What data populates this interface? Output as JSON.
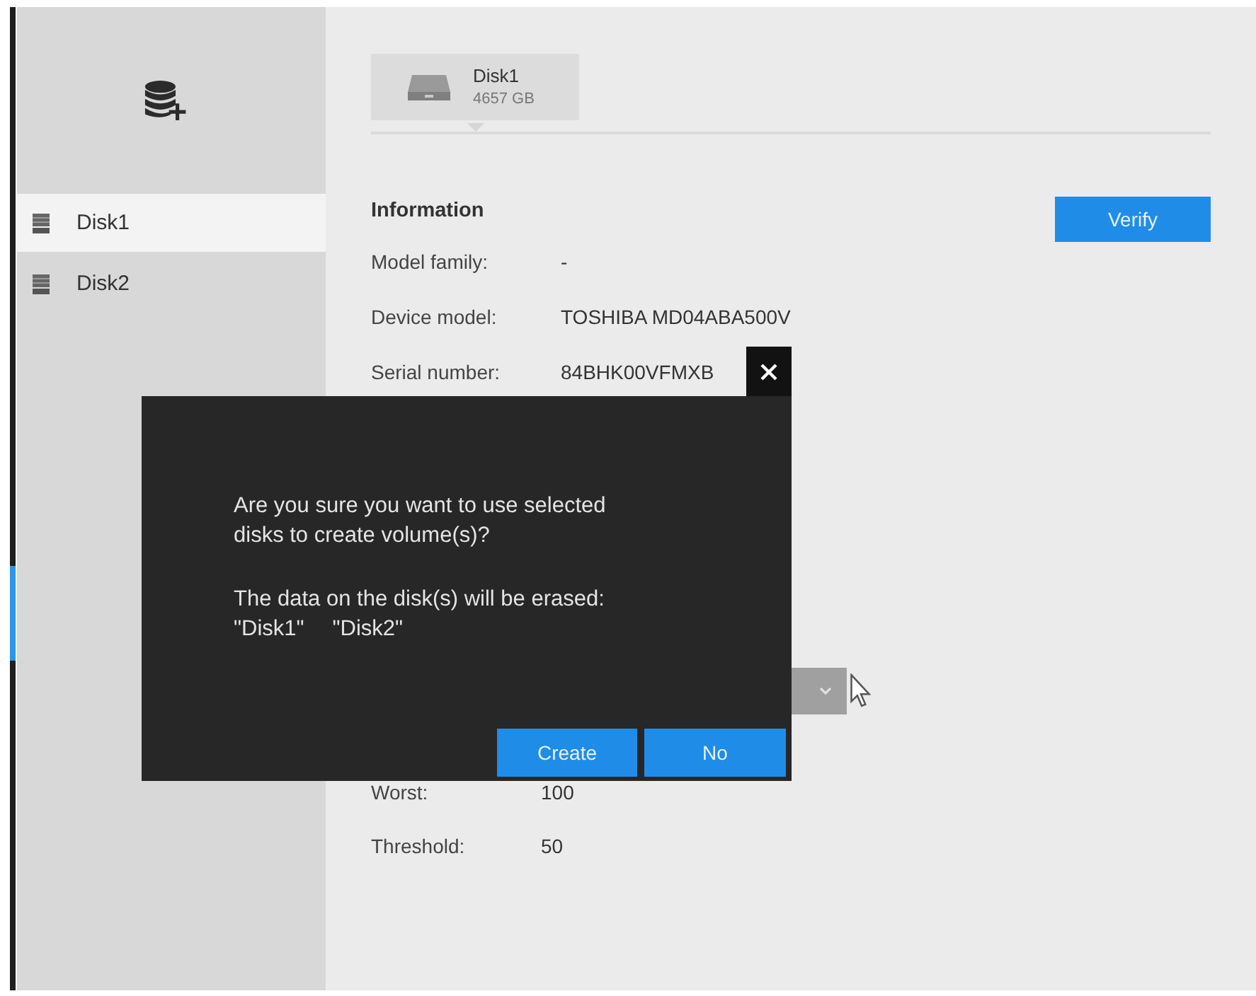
{
  "sidebar": {
    "items": [
      {
        "label": "Disk1",
        "selected": true
      },
      {
        "label": "Disk2",
        "selected": false
      }
    ]
  },
  "disk_tabs": [
    {
      "name": "Disk1",
      "size": "4657 GB",
      "selected": true
    }
  ],
  "information": {
    "title": "Information",
    "verify_button": "Verify",
    "fields": [
      {
        "label": "Model family:",
        "value": "-"
      },
      {
        "label": "Device model:",
        "value": "TOSHIBA MD04ABA500V"
      },
      {
        "label": "Serial number:",
        "value": "84BHK00VFMXB"
      }
    ]
  },
  "smart": {
    "fields": [
      {
        "label": "Worst:",
        "value": "100"
      },
      {
        "label": "Threshold:",
        "value": "50"
      }
    ]
  },
  "dialog": {
    "message": "Are you sure you want to use selected disks to create volume(s)?",
    "warning": "The data on the disk(s) will be erased:",
    "disks": [
      "\"Disk1\"",
      "\"Disk2\""
    ],
    "buttons": [
      {
        "label": "Create"
      },
      {
        "label": "No"
      }
    ]
  }
}
